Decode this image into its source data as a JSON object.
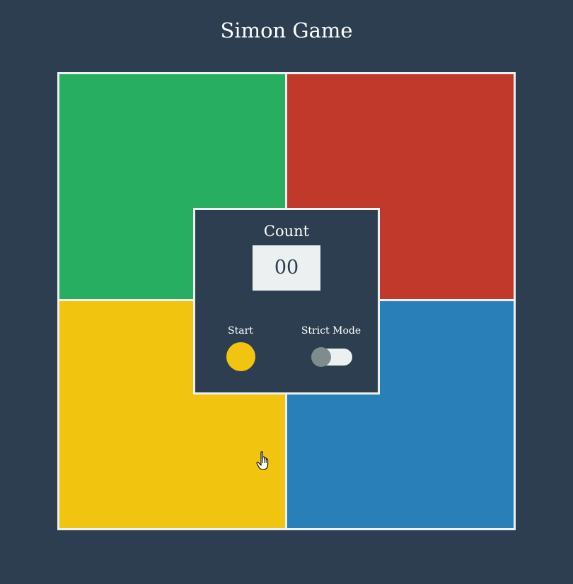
{
  "title": "Simon Game",
  "pads": [
    {
      "name": "green",
      "color": "#27ae60"
    },
    {
      "name": "red",
      "color": "#c0392b"
    },
    {
      "name": "yellow",
      "color": "#f1c40f"
    },
    {
      "name": "blue",
      "color": "#2980b9"
    }
  ],
  "controls": {
    "count_label": "Count",
    "count_value": "00",
    "start_label": "Start",
    "start_color": "#f1c40f",
    "strict_label": "Strict Mode",
    "strict_on": false
  },
  "colors": {
    "background": "#2c3e50",
    "border": "#ecf0f1",
    "toggle_knob_off": "#7f8c8d"
  },
  "cursor": "hand-pointer-icon"
}
